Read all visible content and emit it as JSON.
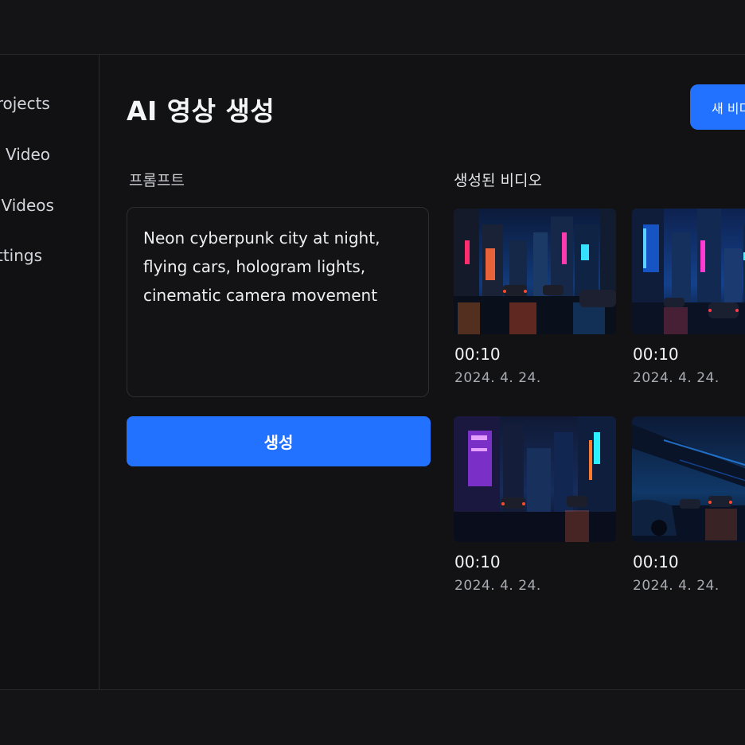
{
  "sidebar": {
    "items": [
      {
        "label": "Projects"
      },
      {
        "label": "New Video"
      },
      {
        "label": "My Videos"
      },
      {
        "label": "Settings"
      }
    ]
  },
  "main": {
    "title": "AI 영상 생성",
    "new_video_button": "새 비디오",
    "prompt": {
      "label": "프롬프트",
      "value": "Neon cyberpunk city at night,\nflying cars, hologram lights,\ncinematic camera movement"
    },
    "generate_button": "생성",
    "gallery": {
      "title": "생성된 비디오",
      "videos": [
        {
          "duration": "00:10",
          "date": "2024. 4. 24."
        },
        {
          "duration": "00:10",
          "date": "2024. 4. 24."
        },
        {
          "duration": "00:10",
          "date": "2024. 4. 24."
        },
        {
          "duration": "00:10",
          "date": "2024. 4. 24."
        }
      ]
    }
  }
}
